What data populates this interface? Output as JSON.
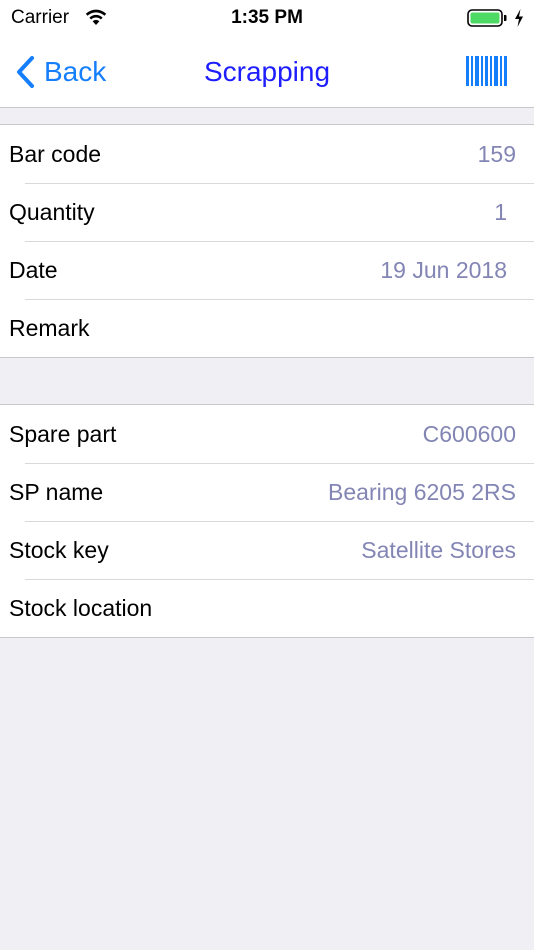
{
  "status_bar": {
    "carrier": "Carrier",
    "time": "1:35 PM",
    "icons": [
      "wifi-icon",
      "battery-icon",
      "charging-bolt-icon"
    ],
    "battery_color": "#4cd964"
  },
  "nav": {
    "back_label": "Back",
    "title": "Scrapping",
    "right_icon": "barcode-icon",
    "accent_color": "#157efb",
    "title_color": "#1d1dff"
  },
  "section1": {
    "rows": [
      {
        "label": "Bar code",
        "value": "159"
      },
      {
        "label": "Quantity",
        "value": "1"
      },
      {
        "label": "Date",
        "value": "19 Jun 2018"
      },
      {
        "label": "Remark",
        "value": ""
      }
    ]
  },
  "section2": {
    "rows": [
      {
        "label": "Spare part",
        "value": "C600600"
      },
      {
        "label": "SP name",
        "value": "Bearing 6205 2RS"
      },
      {
        "label": "Stock key",
        "value": "Satellite Stores"
      },
      {
        "label": "Stock location",
        "value": ""
      }
    ]
  },
  "colors": {
    "background": "#efeff4",
    "value_text": "#8385b4",
    "separator": "#c8c7cc"
  }
}
